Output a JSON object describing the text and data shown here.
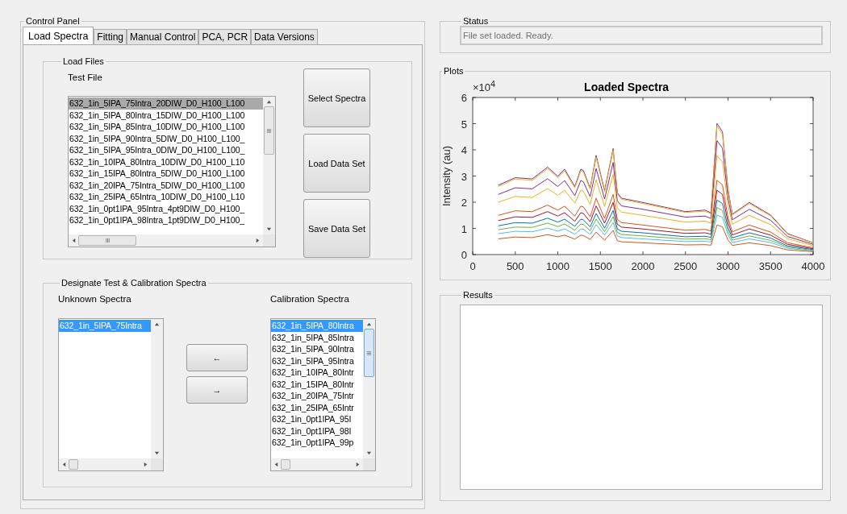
{
  "control_panel": {
    "title": "Control Panel",
    "tabs": [
      {
        "label": "Load Spectra",
        "selected": true
      },
      {
        "label": "Fitting",
        "selected": false
      },
      {
        "label": "Manual Control",
        "selected": false
      },
      {
        "label": "PCA, PCR",
        "selected": false
      },
      {
        "label": "Data Versions",
        "selected": false
      }
    ],
    "load_files": {
      "title": "Load Files",
      "test_file_label": "Test File",
      "test_files": [
        {
          "name": "632_1in_5IPA_75Intra_20DIW_D0_H100_L100",
          "selected": true
        },
        {
          "name": "632_1in_5IPA_80Intra_15DIW_D0_H100_L100",
          "selected": false
        },
        {
          "name": "632_1in_5IPA_85Intra_10DIW_D0_H100_L100",
          "selected": false
        },
        {
          "name": "632_1in_5IPA_90Intra_5DIW_D0_H100_L100_",
          "selected": false
        },
        {
          "name": "632_1in_5IPA_95Intra_0DIW_D0_H100_L100_",
          "selected": false
        },
        {
          "name": "632_1in_10IPA_80Intra_10DIW_D0_H100_L10",
          "selected": false
        },
        {
          "name": "632_1in_15IPA_80Intra_5DIW_D0_H100_L100",
          "selected": false
        },
        {
          "name": "632_1in_20IPA_75Intra_5DIW_D0_H100_L100",
          "selected": false
        },
        {
          "name": "632_1in_25IPA_65Intra_10DIW_D0_H100_L10",
          "selected": false
        },
        {
          "name": "632_1in_0pt1IPA_95Intra_4pt9DIW_D0_H100_",
          "selected": false
        },
        {
          "name": "632_1in_0pt1IPA_98Intra_1pt9DIW_D0_H100_",
          "selected": false
        }
      ],
      "buttons": [
        "Select Spectra",
        "Load Data Set",
        "Save Data Set"
      ]
    },
    "designate": {
      "title": "Designate Test & Calibration Spectra",
      "unknown_label": "Unknown Spectra",
      "unknown": [
        {
          "name": "632_1in_5IPA_75Intra",
          "selected": true
        }
      ],
      "move_buttons": [
        "←",
        "→"
      ],
      "calibration_label": "Calibration Spectra",
      "calibration": [
        {
          "name": "632_1in_5IPA_80Intra",
          "selected": true
        },
        {
          "name": "632_1in_5IPA_85Intra",
          "selected": false
        },
        {
          "name": "632_1in_5IPA_90Intra",
          "selected": false
        },
        {
          "name": "632_1in_5IPA_95Intra",
          "selected": false
        },
        {
          "name": "632_1in_10IPA_80Intr",
          "selected": false
        },
        {
          "name": "632_1in_15IPA_80Intr",
          "selected": false
        },
        {
          "name": "632_1in_20IPA_75Intr",
          "selected": false
        },
        {
          "name": "632_1in_25IPA_65Intr",
          "selected": false
        },
        {
          "name": "632_1in_0pt1IPA_95I",
          "selected": false
        },
        {
          "name": "632_1in_0pt1IPA_98I",
          "selected": false
        },
        {
          "name": "632_1in_0pt1IPA_99p",
          "selected": false
        }
      ]
    }
  },
  "status": {
    "title": "Status",
    "message": "File set loaded. Ready."
  },
  "plots": {
    "title": "Plots",
    "chart_data": {
      "type": "line",
      "title": "Loaded Spectra",
      "ylabel": "Intensity (au)",
      "annotations": [
        {
          "text": "×10$^{4}$"
        }
      ],
      "xlim": [
        0,
        4000
      ],
      "ylim": [
        0,
        6
      ],
      "xticks": [
        0,
        500,
        1000,
        1500,
        2000,
        2500,
        3000,
        3500,
        4000
      ],
      "yticks": [
        0,
        1,
        2,
        3,
        4,
        5,
        6
      ],
      "x": [
        300,
        500,
        700,
        880,
        1000,
        1080,
        1200,
        1270,
        1300,
        1380,
        1450,
        1550,
        1650,
        1700,
        1750,
        2000,
        2500,
        2730,
        2800,
        2870,
        2935,
        3000,
        3050,
        3250,
        3500,
        3700,
        4000
      ],
      "series": [
        {
          "color": "#7e2f8e",
          "values": [
            2.65,
            2.94,
            2.89,
            3.34,
            2.99,
            3.26,
            2.6,
            3.26,
            3.21,
            2.54,
            3.79,
            2.44,
            4.05,
            2.36,
            2.15,
            1.99,
            1.64,
            1.7,
            1.59,
            5.01,
            4.69,
            2.49,
            1.54,
            1.99,
            1.51,
            0.8,
            0.45
          ]
        },
        {
          "color": "#edb120",
          "values": [
            2.6,
            2.89,
            2.83,
            3.28,
            2.94,
            3.2,
            2.55,
            3.2,
            3.15,
            2.5,
            3.72,
            2.39,
            3.98,
            2.31,
            2.11,
            1.95,
            1.61,
            1.66,
            1.56,
            4.91,
            4.6,
            2.44,
            1.51,
            1.95,
            1.48,
            0.78,
            0.44
          ]
        },
        {
          "color": "#7e2f8e",
          "values": [
            2.3,
            2.55,
            2.51,
            2.9,
            2.6,
            2.83,
            2.25,
            2.83,
            2.78,
            2.21,
            3.29,
            2.12,
            3.52,
            2.05,
            1.86,
            1.73,
            1.43,
            1.47,
            1.38,
            4.35,
            4.07,
            2.16,
            1.33,
            1.73,
            1.31,
            0.69,
            0.39
          ]
        },
        {
          "color": "#edb120",
          "values": [
            2,
            2.22,
            2.18,
            2.52,
            2.26,
            2.46,
            1.96,
            2.46,
            2.42,
            1.92,
            2.86,
            1.84,
            3.06,
            1.78,
            1.62,
            1.5,
            1.24,
            1.28,
            1.2,
            3.78,
            3.54,
            1.88,
            1.16,
            1.5,
            1.14,
            0.6,
            0.34
          ]
        },
        {
          "color": "#d95319",
          "values": [
            1.5,
            1.67,
            1.64,
            1.89,
            1.7,
            1.85,
            1.47,
            1.85,
            1.82,
            1.44,
            2.15,
            1.38,
            2.3,
            1.34,
            1.22,
            1.13,
            0.93,
            0.96,
            0.9,
            2.84,
            2.66,
            1.41,
            0.87,
            1.13,
            0.86,
            0.45,
            0.26
          ]
        },
        {
          "color": "#a2142f",
          "values": [
            1.3,
            1.44,
            1.42,
            1.64,
            1.47,
            1.6,
            1.27,
            1.6,
            1.57,
            1.25,
            1.86,
            1.2,
            1.99,
            1.16,
            1.05,
            0.98,
            0.81,
            0.83,
            0.78,
            2.46,
            2.3,
            1.22,
            0.75,
            0.98,
            0.74,
            0.39,
            0.22
          ]
        },
        {
          "color": "#0072bd",
          "values": [
            1.1,
            1.22,
            1.2,
            1.39,
            1.24,
            1.35,
            1.08,
            1.35,
            1.33,
            1.06,
            1.57,
            1.01,
            1.68,
            0.98,
            0.89,
            0.83,
            0.68,
            0.7,
            0.66,
            2.08,
            1.95,
            1.03,
            0.64,
            0.83,
            0.63,
            0.33,
            0.19
          ]
        },
        {
          "color": "#77ac30",
          "values": [
            0.95,
            1.05,
            1.04,
            1.2,
            1.07,
            1.17,
            0.93,
            1.17,
            1.15,
            0.91,
            1.36,
            0.87,
            1.45,
            0.85,
            0.77,
            0.71,
            0.59,
            0.61,
            0.57,
            1.8,
            1.68,
            0.89,
            0.55,
            0.71,
            0.54,
            0.29,
            0.16
          ]
        },
        {
          "color": "#4dbeee",
          "values": [
            0.8,
            0.89,
            0.87,
            1.01,
            0.9,
            0.98,
            0.78,
            0.98,
            0.97,
            0.77,
            1.14,
            0.74,
            1.22,
            0.71,
            0.65,
            0.6,
            0.5,
            0.51,
            0.48,
            1.51,
            1.42,
            0.75,
            0.46,
            0.6,
            0.46,
            0.24,
            0.14
          ]
        },
        {
          "color": "#d95319",
          "values": [
            0.6,
            0.67,
            0.65,
            0.76,
            0.68,
            0.74,
            0.59,
            0.74,
            0.73,
            0.58,
            0.86,
            0.55,
            0.92,
            0.53,
            0.49,
            0.45,
            0.37,
            0.38,
            0.36,
            1.13,
            1.06,
            0.56,
            0.35,
            0.45,
            0.34,
            0.18,
            0.11
          ]
        }
      ]
    }
  },
  "results": {
    "title": "Results"
  }
}
